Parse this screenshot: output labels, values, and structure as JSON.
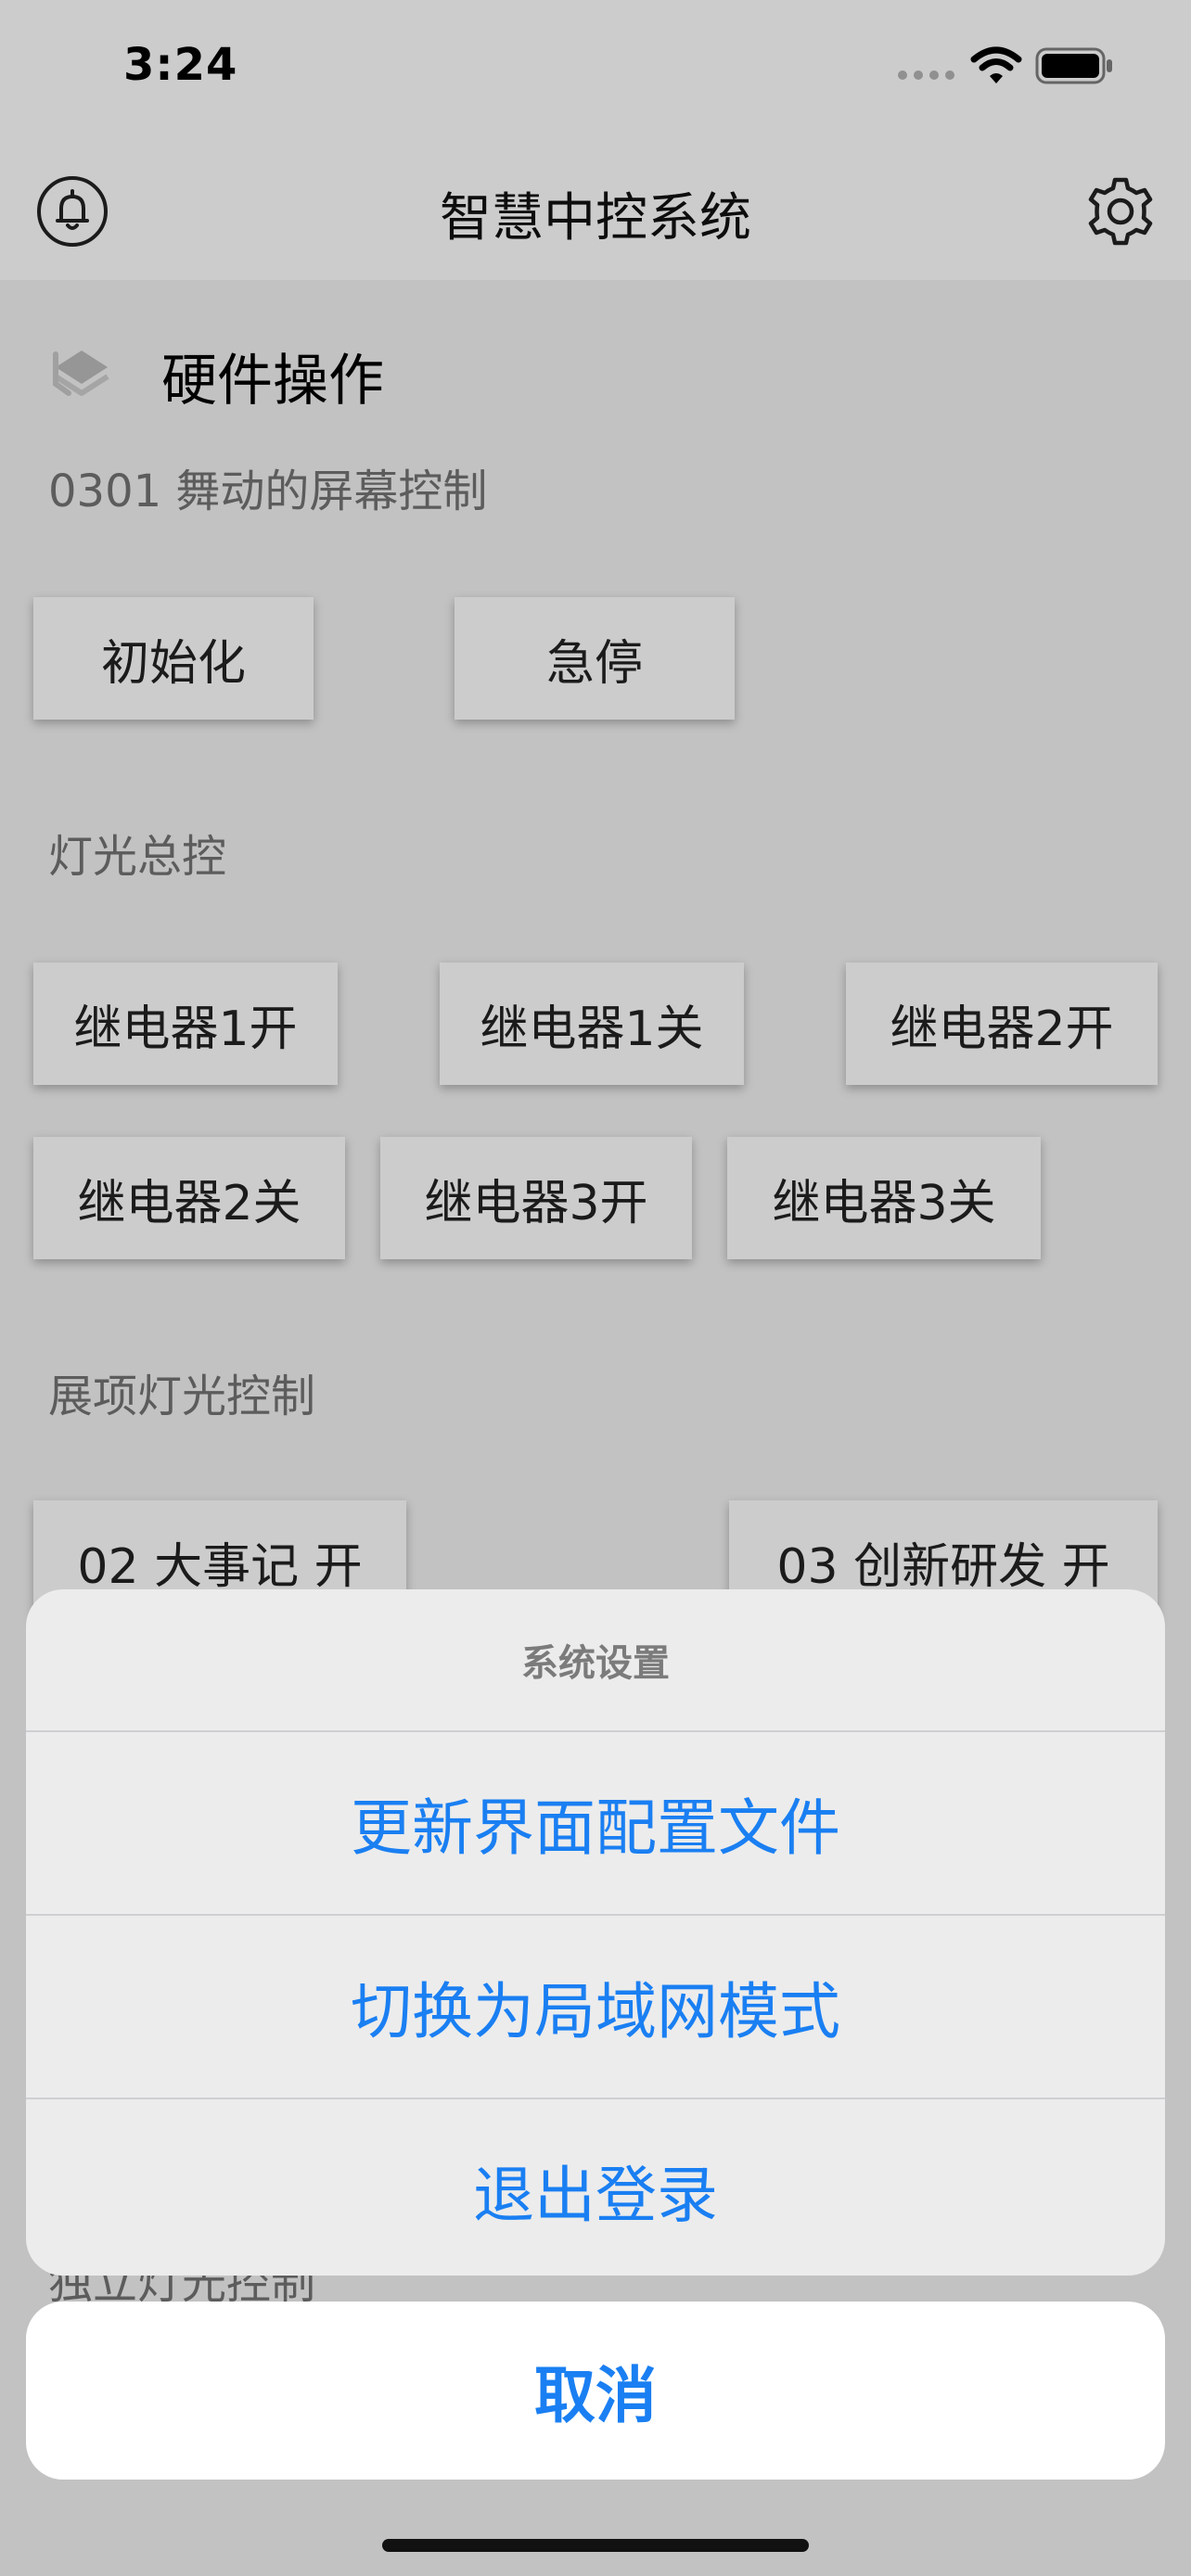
{
  "status_bar": {
    "time": "3:24"
  },
  "nav": {
    "title": "智慧中控系统"
  },
  "section": {
    "title": "硬件操作"
  },
  "groups": [
    {
      "label": "0301 舞动的屏幕控制",
      "buttons": [
        "初始化",
        "急停"
      ]
    },
    {
      "label": "灯光总控",
      "buttons": [
        "继电器1开",
        "继电器1关",
        "继电器2开",
        "继电器2关",
        "继电器3开",
        "继电器3关"
      ]
    },
    {
      "label": "展项灯光控制",
      "buttons": [
        "02 大事记 开",
        "03 创新研发 开"
      ]
    },
    {
      "label": "独立灯光控制"
    }
  ],
  "action_sheet": {
    "title": "系统设置",
    "options": [
      "更新界面配置文件",
      "切换为局域网模式",
      "退出登录"
    ],
    "cancel": "取消"
  },
  "icons": {
    "nav_left": "bell-icon",
    "nav_right": "gear-icon",
    "section": "layers-icon"
  },
  "colors": {
    "action_text": "#1a7ff2",
    "dim_overlay": "rgba(0,0,0,0.2)"
  }
}
